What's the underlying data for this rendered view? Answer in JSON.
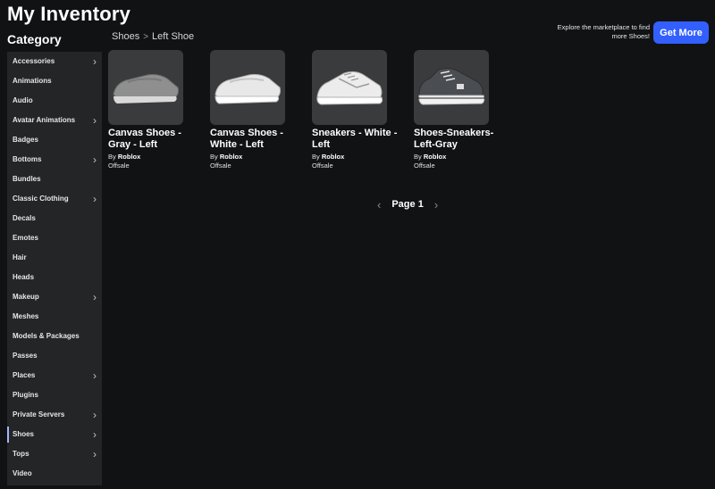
{
  "header": {
    "title": "My Inventory"
  },
  "sidebar": {
    "heading": "Category",
    "items": [
      {
        "label": "Accessories",
        "chevron": true
      },
      {
        "label": "Animations",
        "chevron": false
      },
      {
        "label": "Audio",
        "chevron": false
      },
      {
        "label": "Avatar Animations",
        "chevron": true
      },
      {
        "label": "Badges",
        "chevron": false
      },
      {
        "label": "Bottoms",
        "chevron": true
      },
      {
        "label": "Bundles",
        "chevron": false
      },
      {
        "label": "Classic Clothing",
        "chevron": true
      },
      {
        "label": "Decals",
        "chevron": false
      },
      {
        "label": "Emotes",
        "chevron": false
      },
      {
        "label": "Hair",
        "chevron": false
      },
      {
        "label": "Heads",
        "chevron": false
      },
      {
        "label": "Makeup",
        "chevron": true
      },
      {
        "label": "Meshes",
        "chevron": false
      },
      {
        "label": "Models & Packages",
        "chevron": false
      },
      {
        "label": "Passes",
        "chevron": false
      },
      {
        "label": "Places",
        "chevron": true
      },
      {
        "label": "Plugins",
        "chevron": false
      },
      {
        "label": "Private Servers",
        "chevron": true
      },
      {
        "label": "Shoes",
        "chevron": true,
        "active": true
      },
      {
        "label": "Tops",
        "chevron": true
      },
      {
        "label": "Video",
        "chevron": false
      }
    ]
  },
  "breadcrumb": {
    "parent": "Shoes",
    "separator": ">",
    "current": "Left Shoe"
  },
  "promo": {
    "text": "Explore the marketplace to find more Shoes!",
    "button_label": "Get More",
    "button_color": "#335fff"
  },
  "items": [
    {
      "name": "Canvas Shoes - Gray - Left",
      "by_prefix": "By",
      "creator": "Roblox",
      "status": "Offsale",
      "icon": "gray-canvas-shoe-icon"
    },
    {
      "name": "Canvas Shoes - White - Left",
      "by_prefix": "By",
      "creator": "Roblox",
      "status": "Offsale",
      "icon": "white-canvas-shoe-icon"
    },
    {
      "name": "Sneakers - White - Left",
      "by_prefix": "By",
      "creator": "Roblox",
      "status": "Offsale",
      "icon": "white-sneaker-icon"
    },
    {
      "name": "Shoes-Sneakers-Left-Gray",
      "by_prefix": "By",
      "creator": "Roblox",
      "status": "Offsale",
      "icon": "gray-sneaker-icon"
    }
  ],
  "pagination": {
    "label": "Page 1",
    "prev_icon": "chevron-left-icon",
    "next_icon": "chevron-right-icon"
  },
  "colors": {
    "background": "#111214",
    "sidebar": "#232527",
    "thumb": "#393b3d",
    "active_indicator": "#a8b3ff"
  }
}
